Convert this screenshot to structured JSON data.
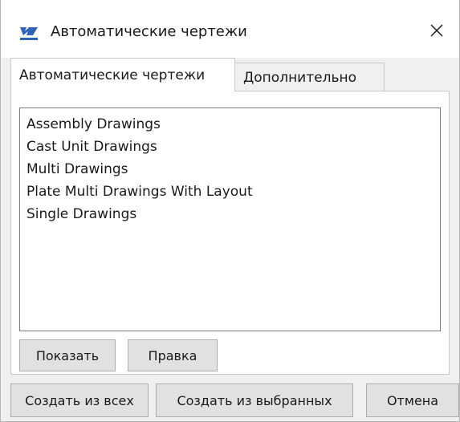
{
  "window": {
    "title": "Автоматические чертежи",
    "icon": "app-drawing-icon",
    "close_glyph": "✕"
  },
  "tabs": [
    {
      "label": "Автоматические чертежи",
      "active": true
    },
    {
      "label": "Дополнительно",
      "active": false
    }
  ],
  "list": {
    "items": [
      "Assembly Drawings",
      "Cast Unit Drawings",
      "Multi Drawings",
      "Plate Multi Drawings With Layout",
      "Single Drawings"
    ]
  },
  "panel_buttons": {
    "show_label": "Показать",
    "edit_label": "Правка"
  },
  "footer_buttons": {
    "create_all_label": "Создать из всех",
    "create_selected_label": "Создать из выбранных",
    "cancel_label": "Отмена"
  }
}
